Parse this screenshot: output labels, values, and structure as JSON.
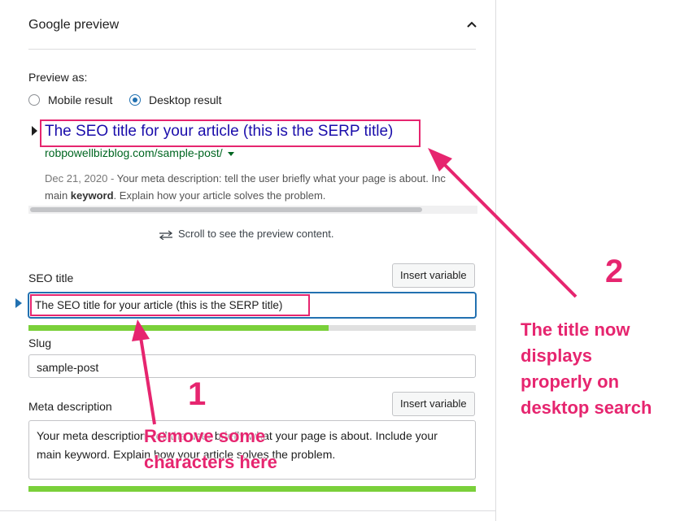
{
  "section": {
    "title": "Google preview"
  },
  "preview": {
    "label": "Preview as:",
    "options": [
      {
        "label": "Mobile result",
        "checked": false
      },
      {
        "label": "Desktop result",
        "checked": true
      }
    ]
  },
  "serp": {
    "title": "The SEO title for your article (this is the SERP title)",
    "url": "robpowellbizblog.com/sample-post/",
    "date": "Dec 21, 2020",
    "date_sep": " - ",
    "desc_line1": "Your meta description: tell the user briefly what your page is about. Inc",
    "desc_line2_pre": "main ",
    "desc_line2_bold": "keyword",
    "desc_line2_post": ". Explain how your article solves the problem.",
    "scroll_hint": "Scroll to see the preview content.",
    "scroll_icon": "arrows-left-right-icon"
  },
  "seo_title": {
    "label": "SEO title",
    "button": "Insert variable",
    "value": "The SEO title for your article (this is the SERP title)",
    "progress": 0.67,
    "progress_color": "#7ad03a"
  },
  "slug": {
    "label": "Slug",
    "value": "sample-post"
  },
  "meta": {
    "label": "Meta description",
    "button": "Insert variable",
    "line1": "Your meta description: tell the user briefly what your page is about. Include your",
    "line2": "main keyword. Explain how your article solves the problem.",
    "progress": 1.0,
    "progress_color": "#7ad03a"
  },
  "annotations": {
    "color": "#e6256f",
    "num1": "1",
    "text1_line1": "Remove some",
    "text1_line2": "characters here",
    "num2": "2",
    "text2_line1": "The title now",
    "text2_line2": "displays",
    "text2_line3": "properly on",
    "text2_line4": "desktop search"
  }
}
